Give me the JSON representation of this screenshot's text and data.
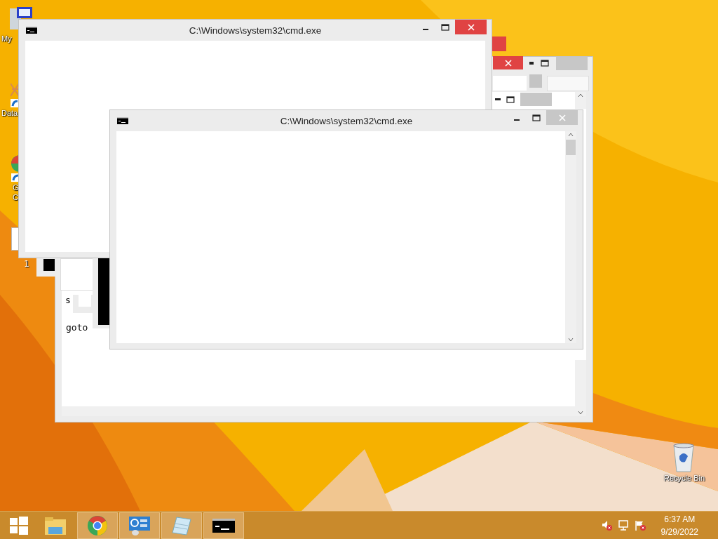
{
  "desktop_icons": [
    {
      "kind": "computer",
      "lines": [
        "My"
      ]
    },
    {
      "kind": "database",
      "lines": [
        "Data"
      ]
    },
    {
      "kind": "chrome",
      "lines": [
        "G",
        "C"
      ]
    },
    {
      "kind": "document"
    },
    {
      "kind": "recycle-bin",
      "lines": [
        "Recycle Bin"
      ]
    }
  ],
  "windows": [
    {
      "kind": "back",
      "content_lines": [
        "goto"
      ]
    },
    {
      "kind": "console",
      "title": "C:\\Windows\\system32\\cmd.exe",
      "close_highlighted": true,
      "vertical_scrollbar": false
    },
    {
      "kind": "console",
      "title": "C:\\Windows\\system32\\cmd.exe",
      "close_highlighted": false,
      "vertical_scrollbar": true
    }
  ],
  "stray_texts": [
    "1",
    "s"
  ],
  "taskbar": {
    "items": [
      {
        "kind": "explorer",
        "running": false
      },
      {
        "kind": "chrome",
        "running": true
      },
      {
        "kind": "control-panel",
        "running": true
      },
      {
        "kind": "notepad",
        "running": true
      },
      {
        "kind": "console",
        "running": true
      }
    ],
    "time": "6:37 AM",
    "date": "9/29/2022"
  }
}
